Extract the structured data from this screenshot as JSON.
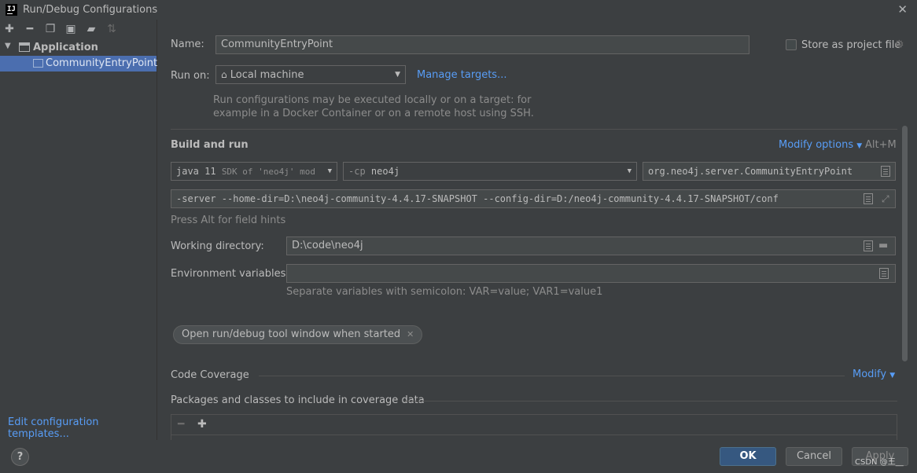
{
  "window": {
    "title": "Run/Debug Configurations",
    "logo": "IJ"
  },
  "sidebar": {
    "tree": {
      "group_label": "Application",
      "selected_item": "CommunityEntryPoint"
    },
    "edit_templates_link": "Edit configuration templates..."
  },
  "form": {
    "name_label": "Name:",
    "name_value": "CommunityEntryPoint",
    "store_as_project_label": "Store as project file",
    "run_on_label": "Run on:",
    "run_on_value": "Local machine",
    "manage_targets_link": "Manage targets...",
    "run_on_hint_line1": "Run configurations may be executed locally or on a target: for",
    "run_on_hint_line2": "example in a Docker Container or on a remote host using SSH.",
    "build_and_run_title": "Build and run",
    "modify_options_link": "Modify options",
    "modify_options_shortcut": "Alt+M",
    "jdk_value_main": "java 11",
    "jdk_value_sub": "SDK of 'neo4j' mod",
    "cp_prefix": "-cp",
    "cp_value": "neo4j",
    "main_class_value": "org.neo4j.server.CommunityEntryPoint",
    "program_args_value": "-server --home-dir=D:\\neo4j-community-4.4.17-SNAPSHOT  --config-dir=D:/neo4j-community-4.4.17-SNAPSHOT/conf",
    "field_hints_text": "Press Alt for field hints",
    "working_dir_label": "Working directory:",
    "working_dir_value": "D:\\code\\neo4j",
    "env_vars_label": "Environment variables:",
    "env_vars_value": "",
    "env_vars_hint": "Separate variables with semicolon: VAR=value; VAR1=value1",
    "tool_window_chip": "Open run/debug tool window when started",
    "code_coverage_title": "Code Coverage",
    "modify_link": "Modify",
    "packages_title": "Packages and classes to include in coverage data"
  },
  "buttons": {
    "help_label": "?",
    "ok_label": "OK",
    "cancel_label": "Cancel",
    "apply_label": "Apply"
  },
  "watermark": "CSDN @王__",
  "colors": {
    "background": "#3c3f41",
    "field_background": "#45494a",
    "selection": "#4b6eaf",
    "link": "#589df6",
    "ok_button": "#365880"
  }
}
